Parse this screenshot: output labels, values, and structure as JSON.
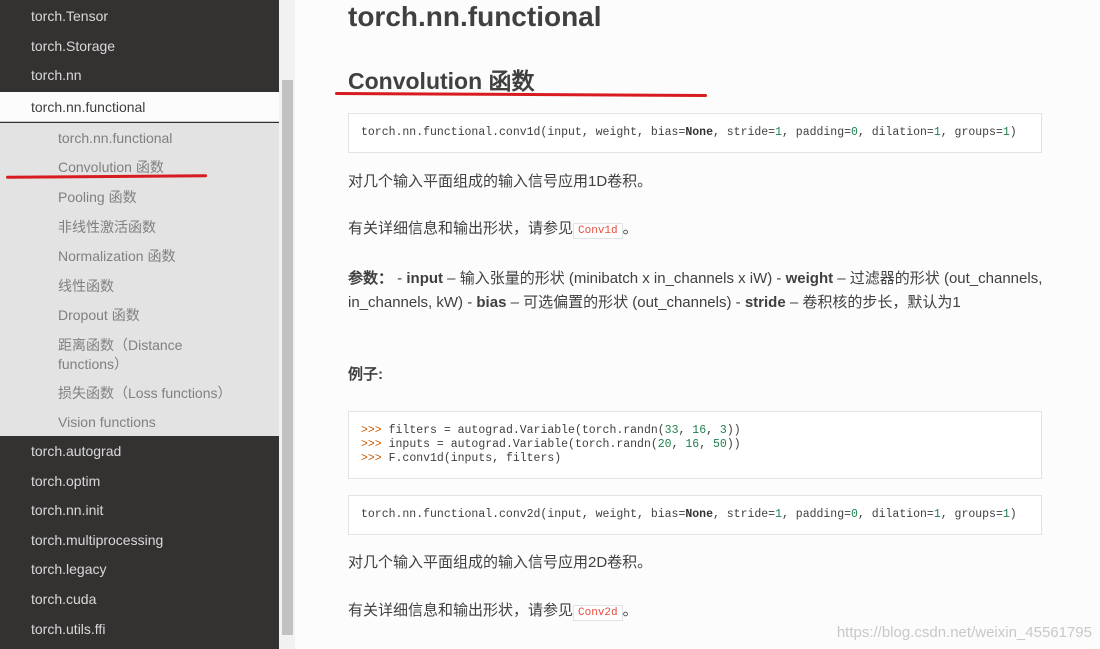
{
  "sidebar": {
    "top_items": [
      "torch.Tensor",
      "torch.Storage",
      "torch.nn"
    ],
    "current_item": "torch.nn.functional",
    "sub_items": [
      "torch.nn.functional",
      "Convolution 函数",
      "Pooling 函数",
      "非线性激活函数",
      "Normalization 函数",
      "线性函数",
      "Dropout 函数",
      "距离函数（Distance functions）",
      "损失函数（Loss functions）",
      "Vision functions"
    ],
    "bottom_items": [
      "torch.autograd",
      "torch.optim",
      "torch.nn.init",
      "torch.multiprocessing",
      "torch.legacy",
      "torch.cuda",
      "torch.utils.ffi"
    ]
  },
  "main": {
    "title": "torch.nn.functional",
    "section_title": "Convolution 函数",
    "conv1d": {
      "prefix": "torch.nn.functional.conv1d(input, weight, bias=",
      "none": "None",
      "stride_label": ", stride=",
      "stride": "1",
      "padding_label": ", padding=",
      "padding": "0",
      "dilation_label": ", dilation=",
      "dilation": "1",
      "groups_label": ", groups=",
      "groups": "1",
      "suffix": ")",
      "desc": "对几个输入平面组成的输入信号应用1D卷积。",
      "see_prefix": "有关详细信息和输出形状，请参见",
      "see_link": "Conv1d",
      "see_suffix": "。"
    },
    "params": {
      "label": "参数：",
      "t1": " - ",
      "input_kw": "input",
      "t2": " – 输入张量的形状 (minibatch x in_channels x iW) - ",
      "weight_kw": "weight",
      "t3": " – 过滤器的形状 (out_channels, in_channels, kW) - ",
      "bias_kw": "bias",
      "t4": " – 可选偏置的形状 (out_channels) - ",
      "stride_kw": "stride",
      "t5": " – 卷积核的步长，默认为1"
    },
    "example": {
      "label": "例子:",
      "prompt": ">>>",
      "l1a": " filters = autograd.Variable(torch.randn(",
      "l1n1": "33",
      "l1c1": ", ",
      "l1n2": "16",
      "l1c2": ", ",
      "l1n3": "3",
      "l1e": "))",
      "l2a": " inputs = autograd.Variable(torch.randn(",
      "l2n1": "20",
      "l2c1": ", ",
      "l2n2": "16",
      "l2c2": ", ",
      "l2n3": "50",
      "l2e": "))",
      "l3": " F.conv1d(inputs, filters)"
    },
    "conv2d": {
      "prefix": "torch.nn.functional.conv2d(input, weight, bias=",
      "desc": "对几个输入平面组成的输入信号应用2D卷积。",
      "see_link": "Conv2d"
    },
    "watermark": "https://blog.csdn.net/weixin_45561795"
  }
}
